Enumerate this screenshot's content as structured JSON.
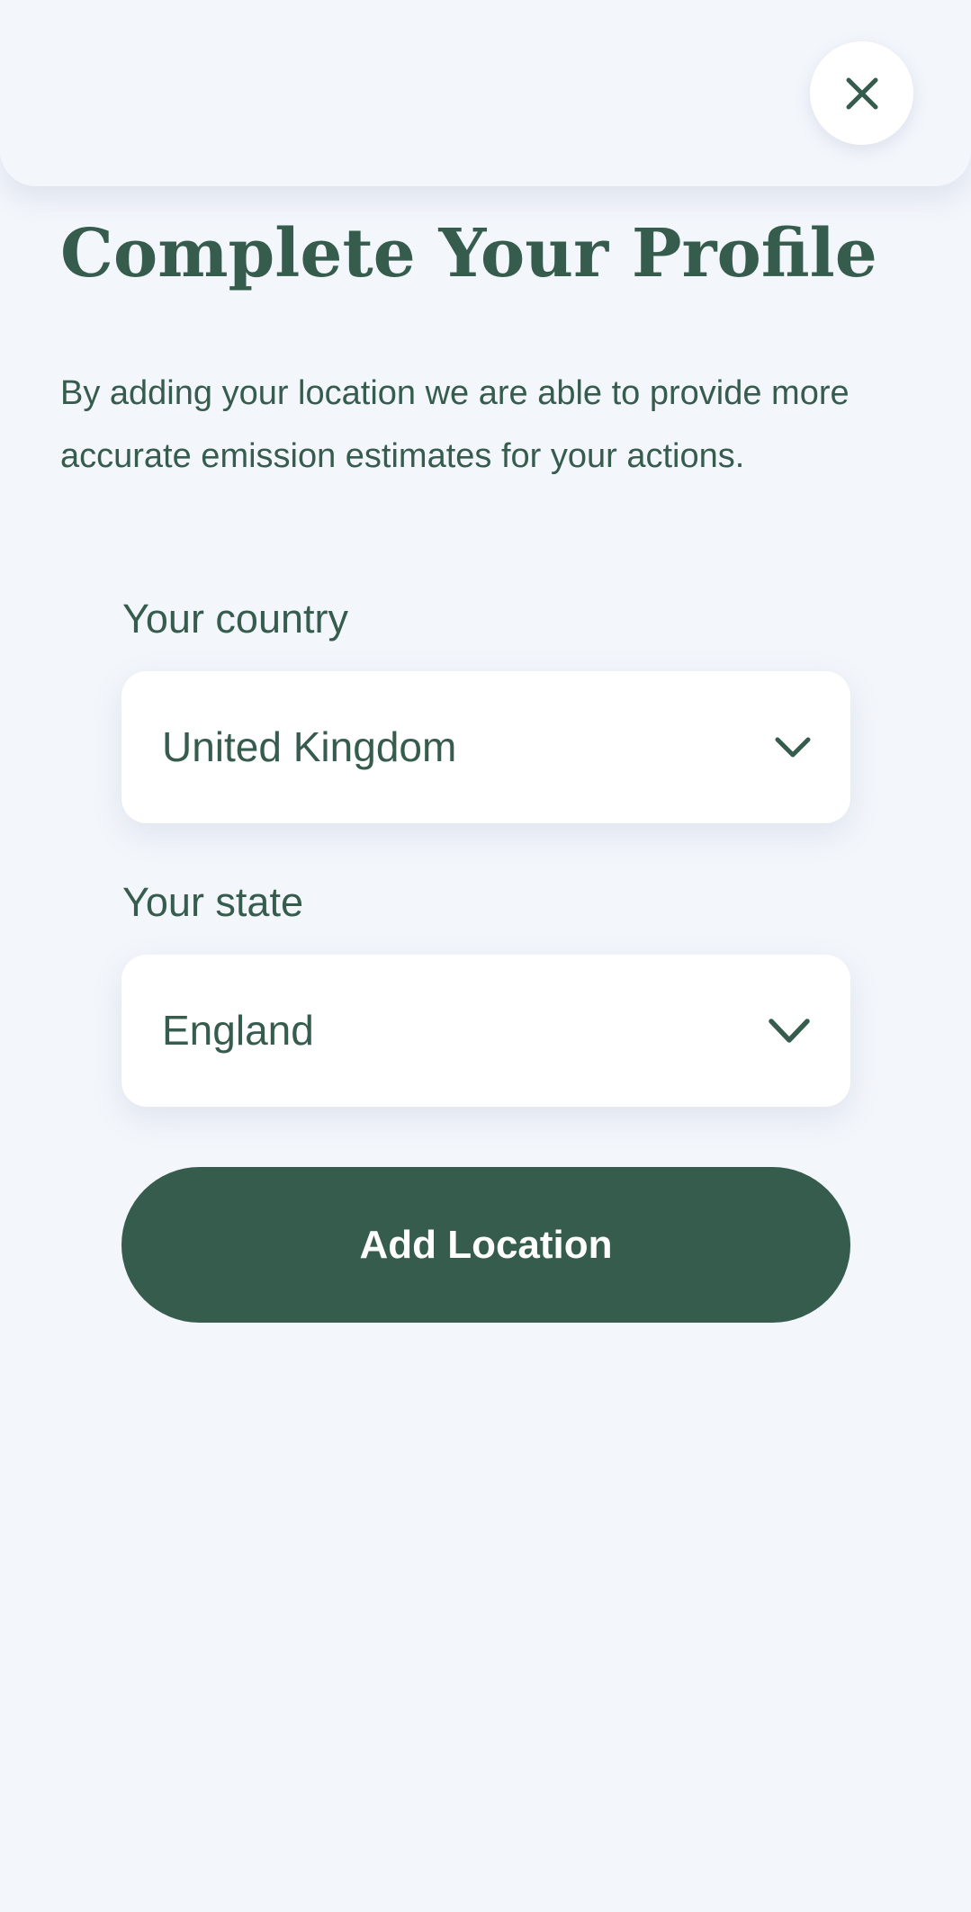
{
  "colors": {
    "background": "#f3f6fb",
    "primary": "#365c4d",
    "surface": "#ffffff",
    "button_text": "#ffffff"
  },
  "header": {
    "close_icon": "close-icon"
  },
  "profile": {
    "title": "Complete Your Profile",
    "description": "By adding your location we are able to provide more accurate emission estimates for your actions."
  },
  "form": {
    "country": {
      "label": "Your country",
      "value": "United Kingdom",
      "icon": "chevron-down-icon"
    },
    "state": {
      "label": "Your state",
      "value": "England",
      "icon": "chevron-down-icon"
    },
    "submit_label": "Add Location"
  }
}
